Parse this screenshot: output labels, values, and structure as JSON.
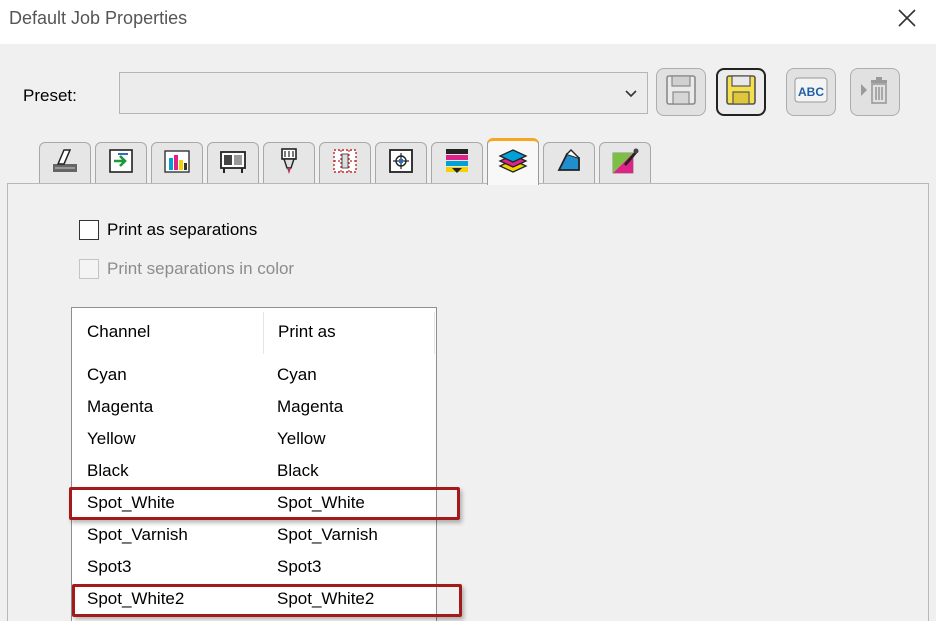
{
  "window": {
    "title": "Default Job Properties"
  },
  "preset": {
    "label": "Preset:",
    "value": ""
  },
  "toolbar": {
    "buttons": [
      {
        "name": "save-preset-button",
        "icon": "floppy-disk-icon"
      },
      {
        "name": "save-as-preset-button",
        "icon": "floppy-disk-yellow-icon"
      },
      {
        "name": "rename-preset-button",
        "icon": "abc-rename-icon"
      },
      {
        "name": "delete-preset-button",
        "icon": "trash-icon"
      }
    ]
  },
  "tabs": [
    {
      "icon": "printer-setup-icon"
    },
    {
      "icon": "transfer-icon"
    },
    {
      "icon": "color-bottles-icon"
    },
    {
      "icon": "print-mode-icon"
    },
    {
      "icon": "print-head-icon"
    },
    {
      "icon": "tile-grid-icon"
    },
    {
      "icon": "target-icon"
    },
    {
      "icon": "color-bars-icon"
    },
    {
      "icon": "layers-icon",
      "active": true
    },
    {
      "icon": "shape-icon"
    },
    {
      "icon": "color-picker-icon"
    }
  ],
  "separations": {
    "print_as_separations": {
      "label": "Print as separations",
      "checked": false
    },
    "print_in_color": {
      "label": "Print separations in color",
      "checked": false,
      "disabled": true
    }
  },
  "channel_list": {
    "columns": [
      "Channel",
      "Print as"
    ],
    "rows": [
      {
        "channel": "Cyan",
        "print_as": "Cyan"
      },
      {
        "channel": "Magenta",
        "print_as": "Magenta"
      },
      {
        "channel": "Yellow",
        "print_as": "Yellow"
      },
      {
        "channel": "Black",
        "print_as": "Black"
      },
      {
        "channel": "Spot_White",
        "print_as": "Spot_White",
        "highlighted": true
      },
      {
        "channel": "Spot_Varnish",
        "print_as": "Spot_Varnish"
      },
      {
        "channel": "Spot3",
        "print_as": "Spot3"
      },
      {
        "channel": "Spot_White2",
        "print_as": "Spot_White2",
        "highlighted": true
      }
    ]
  },
  "colors": {
    "highlight_border": "#a31a1a",
    "active_tab_accent": "#f5a623"
  }
}
